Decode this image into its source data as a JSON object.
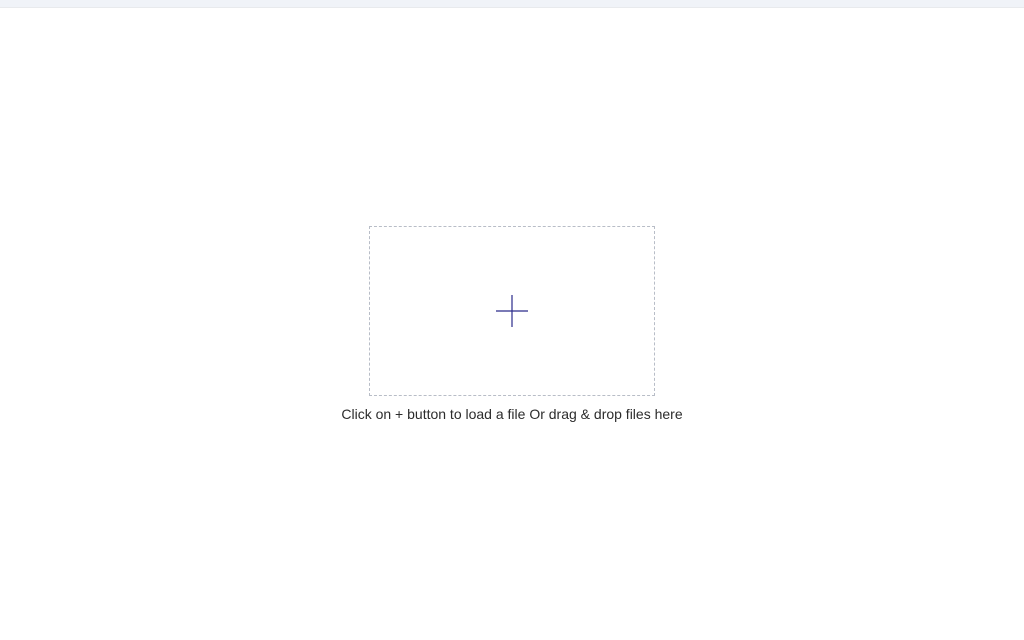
{
  "upload": {
    "hint_text": "Click on + button to load a file Or drag & drop files here",
    "icon_color": "#2a2a8a"
  }
}
